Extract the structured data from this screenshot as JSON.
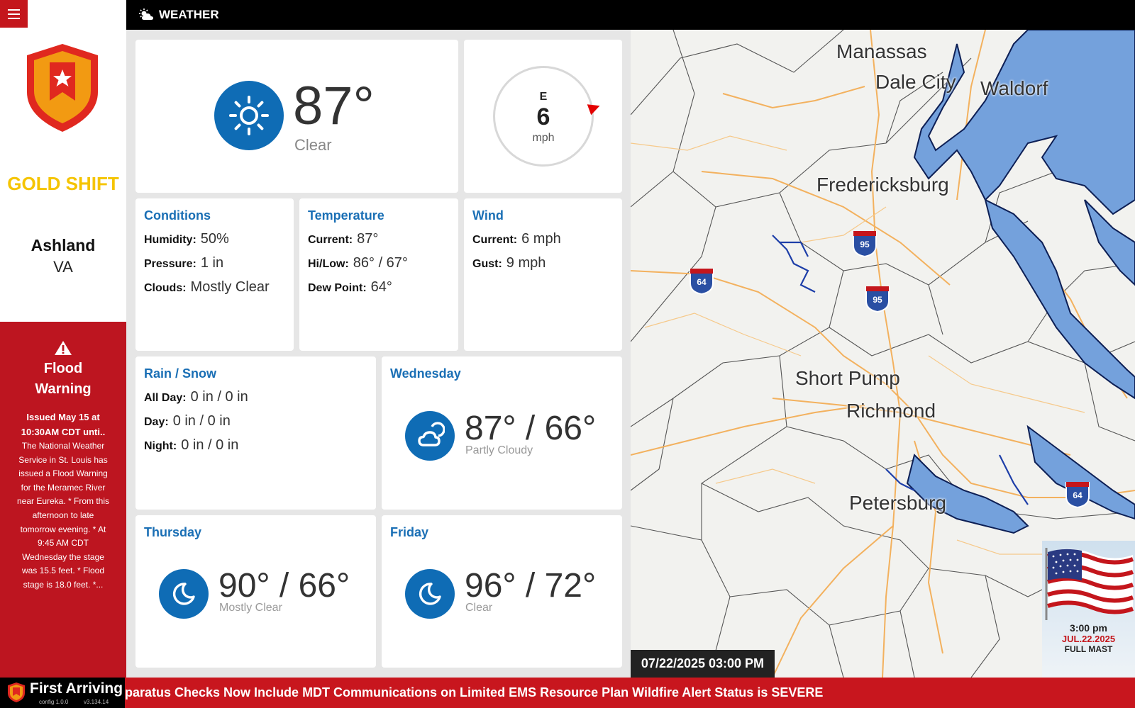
{
  "sidebar": {
    "shift": "GOLD SHIFT",
    "city": "Ashland",
    "state": "VA",
    "alert": {
      "title_line1": "Flood",
      "title_line2": "Warning",
      "issued": "Issued May 15 at 10:30AM CDT unti..",
      "body": "The National Weather Service in St. Louis has issued a Flood Warning for the Meramec River near Eureka. * From this afternoon to late tomorrow evening. * At 9:45 AM CDT Wednesday the stage was 15.5 feet. * Flood stage is 18.0 feet. *..."
    }
  },
  "header": {
    "title": "WEATHER"
  },
  "current": {
    "temp": "87°",
    "condition": "Clear",
    "icon": "sun-icon"
  },
  "wind_dial": {
    "direction": "E",
    "speed": "6",
    "unit": "mph"
  },
  "conditions": {
    "title": "Conditions",
    "humidity_label": "Humidity:",
    "humidity": "50%",
    "pressure_label": "Pressure:",
    "pressure": "1 in",
    "clouds_label": "Clouds:",
    "clouds": "Mostly Clear"
  },
  "temperature": {
    "title": "Temperature",
    "current_label": "Current:",
    "current": "87°",
    "hilow_label": "Hi/Low:",
    "hilow": "86° / 67°",
    "dew_label": "Dew Point:",
    "dew": "64°"
  },
  "wind": {
    "title": "Wind",
    "current_label": "Current:",
    "current": "6 mph",
    "gust_label": "Gust:",
    "gust": "9 mph"
  },
  "rain": {
    "title": "Rain / Snow",
    "allday_label": "All Day:",
    "allday": "0 in / 0 in",
    "day_label": "Day:",
    "day": "0 in / 0 in",
    "night_label": "Night:",
    "night": "0 in / 0 in"
  },
  "forecast": [
    {
      "day": "Wednesday",
      "temps": "87° / 66°",
      "condition": "Partly Cloudy",
      "icon": "partly-cloudy-icon"
    },
    {
      "day": "Thursday",
      "temps": "90° / 66°",
      "condition": "Mostly Clear",
      "icon": "moon-icon"
    },
    {
      "day": "Friday",
      "temps": "96° / 72°",
      "condition": "Clear",
      "icon": "moon-icon"
    }
  ],
  "map": {
    "labels": [
      "Manassas",
      "Dale City",
      "Waldorf",
      "Fredericksburg",
      "Short Pump",
      "Richmond",
      "Petersburg"
    ],
    "shields": [
      "95",
      "95",
      "64",
      "64"
    ],
    "timestamp": "07/22/2025 03:00 PM",
    "flag": {
      "time": "3:00 pm",
      "date": "JUL.22.2025",
      "status": "FULL MAST"
    }
  },
  "footer": {
    "brand": "First Arriving",
    "config": "config 1.0.0",
    "version": "v3.134.14",
    "ticker": "paratus Checks Now Include MDT Communications on Limited EMS Resource Plan Wildfire Alert Status is SEVERE"
  },
  "colors": {
    "accent_blue": "#0f6cb5",
    "alert_red": "#bd1520",
    "shift_gold": "#f5c400"
  }
}
